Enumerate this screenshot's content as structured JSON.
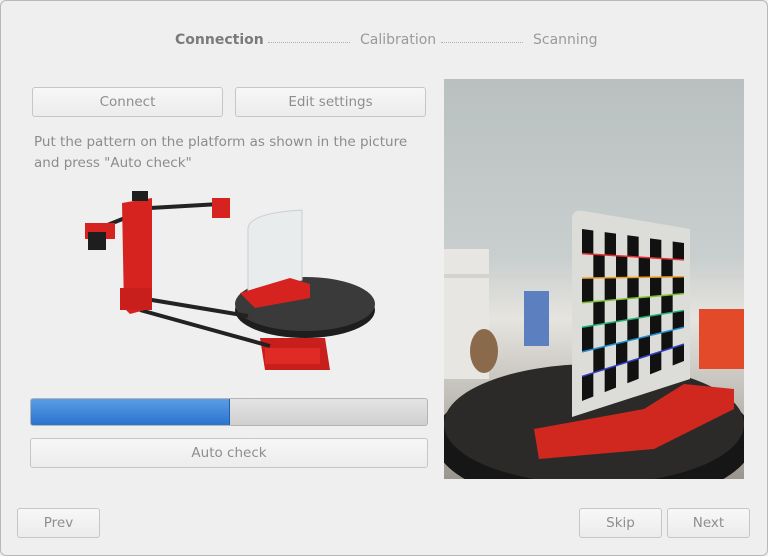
{
  "steps": [
    {
      "label": "Connection",
      "active": true
    },
    {
      "label": "Calibration",
      "active": false
    },
    {
      "label": "Scanning",
      "active": false
    }
  ],
  "buttons": {
    "connect": "Connect",
    "edit_settings": "Edit settings",
    "auto_check": "Auto check",
    "prev": "Prev",
    "skip": "Skip",
    "next": "Next"
  },
  "instruction": "Put the pattern on the platform as shown in the picture and press \"Auto check\"",
  "progress": {
    "value": 0.5
  },
  "colors": {
    "accent": "#2a74cf",
    "scanner_red": "#d6231f",
    "pattern_bg": "#e9e9e9"
  }
}
